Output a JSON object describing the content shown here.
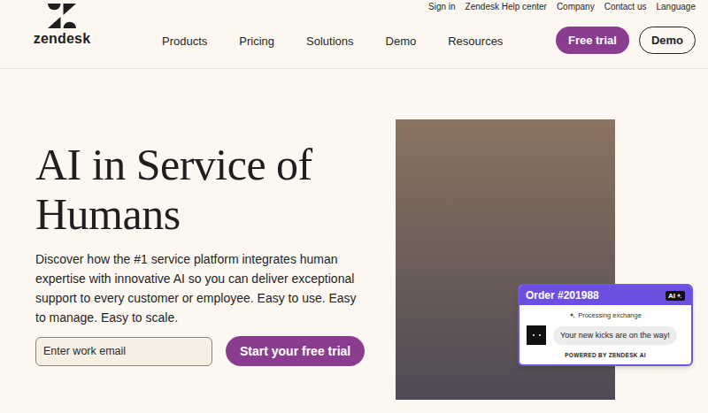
{
  "utility_nav": [
    "Sign in",
    "Zendesk Help center",
    "Company",
    "Contact us",
    "Language"
  ],
  "logo": {
    "text": "zendesk"
  },
  "main_nav": [
    "Products",
    "Pricing",
    "Solutions",
    "Demo",
    "Resources"
  ],
  "header_buttons": [
    {
      "label": "Free trial",
      "kind": "primary"
    },
    {
      "label": "Demo",
      "kind": "outline"
    }
  ],
  "hero": {
    "title_lines": [
      "AI in Service of",
      "Humans"
    ],
    "description": "Discover how the #1 service platform integrates human expertise with innovative AI so you can deliver exceptional support to every customer or employee. Easy to use. Easy to manage. Easy to scale.",
    "email_placeholder": "Enter work email",
    "cta": "Start your free trial"
  },
  "order_card": {
    "title": "Order #201988",
    "badge": "AI",
    "status": "Processing exchange",
    "message": "Your new kicks are on the way!",
    "footer": "POWERED BY ZENDESK AI"
  }
}
